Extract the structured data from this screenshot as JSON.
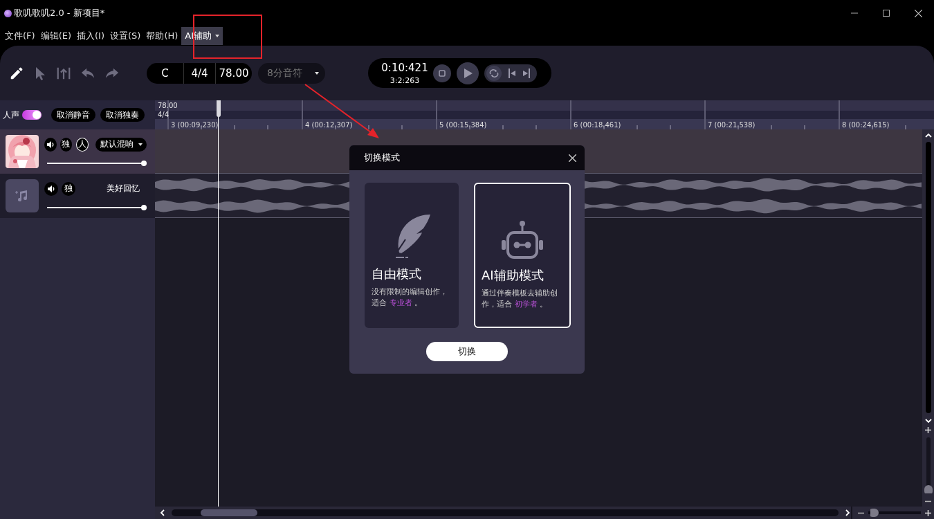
{
  "window": {
    "title": "歌叽歌叽2.0 - 新项目*"
  },
  "menus": [
    {
      "label": "文件(F)",
      "selected": false,
      "dropdown": false
    },
    {
      "label": "编辑(E)",
      "selected": false,
      "dropdown": false
    },
    {
      "label": "插入(I)",
      "selected": false,
      "dropdown": false
    },
    {
      "label": "设置(S)",
      "selected": false,
      "dropdown": false
    },
    {
      "label": "帮助(H)",
      "selected": false,
      "dropdown": false
    },
    {
      "label": "AI辅助",
      "selected": true,
      "dropdown": true
    }
  ],
  "toolbar": {
    "tools": [
      {
        "kind": "pencil",
        "selected": true
      },
      {
        "kind": "cursor",
        "selected": false
      },
      {
        "kind": "split",
        "selected": false
      },
      {
        "kind": "undo",
        "selected": false
      },
      {
        "kind": "redo",
        "selected": false
      }
    ],
    "key": "C",
    "time_signature": "4/4",
    "tempo": "78.00",
    "note_value": "8分音符",
    "transport": {
      "time": "0:10:421",
      "position": "3:2:263"
    }
  },
  "track_header": {
    "vocal_toggle": {
      "label": "人声",
      "on": true
    },
    "buttons": [
      "取消静音",
      "取消独奏"
    ]
  },
  "tracks": [
    {
      "kind": "vocal",
      "solo": "独",
      "voice": "人",
      "reverb": "默认混响",
      "level": 1
    },
    {
      "kind": "instrument",
      "solo": "独",
      "name": "美好回忆",
      "level": 1
    }
  ],
  "ruler": {
    "tempo": "78.00",
    "meter": "4/4",
    "bars": [
      "3 (00:09.230)",
      "4 (00:12.307)",
      "5 (00:15.384)",
      "6 (00:18.461)",
      "7 (00:21.538)",
      "8 (00:24.615)"
    ]
  },
  "horizontal_zoom": {
    "level": 0.05
  },
  "vertical_zoom": {
    "level": 0.03
  },
  "dialog": {
    "title": "切换模式",
    "modes": [
      {
        "kind": "free",
        "title": "自由模式",
        "description": "没有限制的编辑创作，适合",
        "audience": "专业者",
        "suffix": "。",
        "selected": false
      },
      {
        "kind": "ai",
        "title": "AI辅助模式",
        "description": "通过伴奏模板去辅助创作，适合",
        "audience": "初学者",
        "suffix": "。",
        "selected": true
      }
    ],
    "button": "切换"
  }
}
